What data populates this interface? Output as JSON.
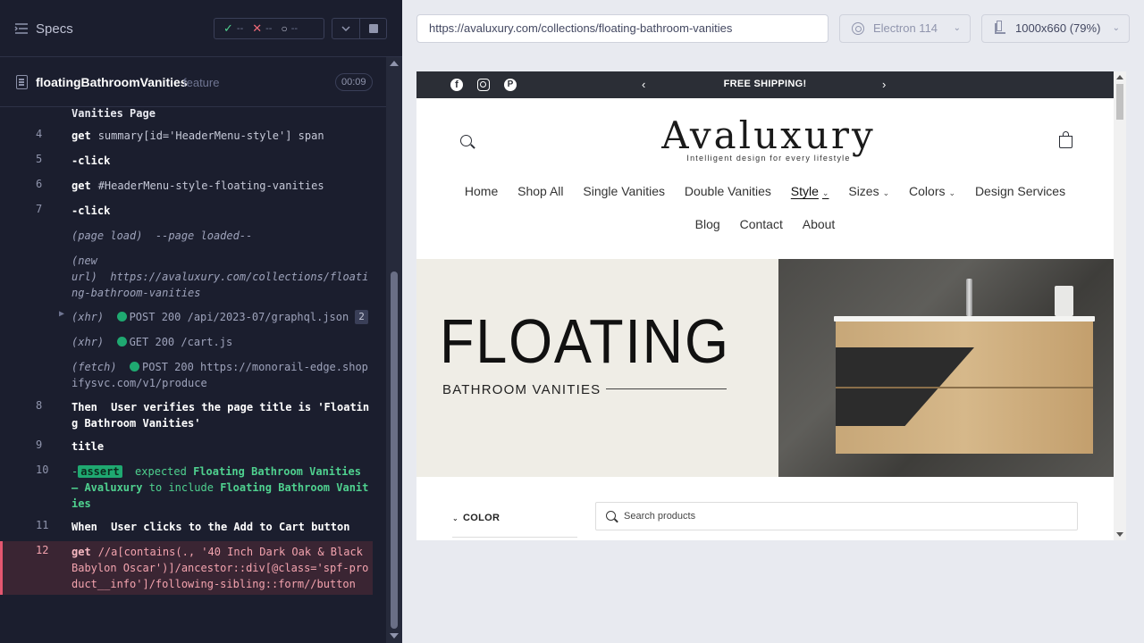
{
  "runner": {
    "specs_label": "Specs",
    "stats": {
      "passed": "--",
      "failed": "--",
      "pending": "--"
    },
    "spec_name": "floatingBathroomVanities",
    "spec_ext": "feature",
    "duration": "00:09"
  },
  "log": {
    "partial_label": "Vanities Page",
    "rows": [
      {
        "num": "4",
        "cmd": "get",
        "arg": "summary[id='HeaderMenu-style'] span"
      },
      {
        "num": "5",
        "cmd": "-click"
      },
      {
        "num": "6",
        "cmd": "get",
        "arg": "#HeaderMenu-style-floating-vanities"
      },
      {
        "num": "7",
        "cmd": "-click"
      }
    ],
    "page_load": "(page load)",
    "page_loaded": "--page loaded--",
    "new_url_label_1": "(new",
    "new_url_label_2": "url)",
    "new_url": "https://avaluxury.com/collections/floating-bathroom-vanities",
    "xhr1_label": "(xhr)",
    "xhr1": "POST 200 /api/2023-07/graphql.json",
    "xhr1_count": "2",
    "xhr2_label": "(xhr)",
    "xhr2": "GET 200 /cart.js",
    "fetch_label": "(fetch)",
    "fetch": "POST 200 https://monorail-edge.shopifysvc.com/v1/produce",
    "step8_num": "8",
    "step8_kw": "Then",
    "step8_text": "User verifies the page title is 'Floating Bathroom Vanities'",
    "step9_num": "9",
    "step9_cmd": "title",
    "step10_num": "10",
    "assert_tag": "assert",
    "assert_expected": "expected",
    "assert_value": "Floating Bathroom Vanities – Avaluxury",
    "assert_include": "to include",
    "assert_target": "Floating Bathroom Vanities",
    "step11_num": "11",
    "step11_kw": "When",
    "step11_text": "User clicks to the Add to Cart button",
    "step12_num": "12",
    "step12_cmd": "get",
    "step12_arg": "//a[contains(., '40 Inch Dark Oak & Black Babylon Oscar')]/ancestor::div[@class='spf-product__info']/following-sibling::form//button"
  },
  "browser": {
    "url": "https://avaluxury.com/collections/floating-bathroom-vanities",
    "name": "Electron 114",
    "viewport": "1000x660  (79%)"
  },
  "site": {
    "announcement": "FREE SHIPPING!",
    "fb_glyph": "f",
    "pin_glyph": "P",
    "logo": "Avaluxury",
    "tagline": "Intelligent design for every lifestyle",
    "nav1": [
      "Home",
      "Shop All",
      "Single Vanities",
      "Double Vanities",
      "Style",
      "Sizes",
      "Colors",
      "Design Services"
    ],
    "nav2": [
      "Blog",
      "Contact",
      "About"
    ],
    "hero_title": "FLOATING",
    "hero_sub": "BATHROOM VANITIES",
    "filter_color": "COLOR",
    "search_placeholder": "Search products"
  },
  "colors": {
    "runner_bg": "#1b1e2e",
    "pass": "#1fa971",
    "fail": "#e45770",
    "announcement_bg": "#2b2e36"
  }
}
